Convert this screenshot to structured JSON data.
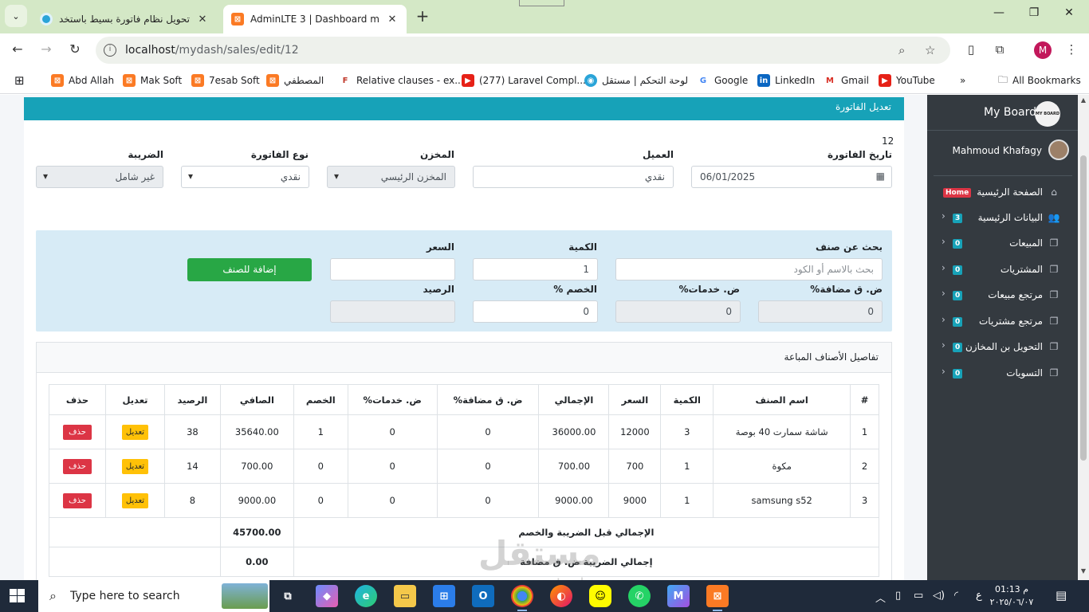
{
  "browser": {
    "tabs": [
      {
        "title": "تحويل نظام فاتورة بسيط باستخدام",
        "active": false
      },
      {
        "title": "AdminLTE 3 | Dashboard mood",
        "active": true
      }
    ],
    "url_host": "localhost",
    "url_path": "/mydash/sales/edit/12",
    "bookmarks": [
      "Abd Allah",
      "Mak Soft",
      "7esab Soft",
      "المصطفي",
      "Relative clauses - ex...",
      "(277) Laravel Compl...",
      "لوحة التحكم | مستقل",
      "Google",
      "LinkedIn",
      "Gmail",
      "YouTube"
    ],
    "all_bookmarks": "All Bookmarks",
    "profile_initial": "M"
  },
  "page": {
    "card_title": "تعديل الفاتورة",
    "invoice_number": "12",
    "labels": {
      "date": "تاريخ الفاتورة",
      "customer": "العميل",
      "store": "المخزن",
      "invoice_type": "نوع الفاتورة",
      "tax": "الضريبة"
    },
    "values": {
      "date": "06/01/2025",
      "customer": "نقدي",
      "store": "المخزن الرئيسي",
      "invoice_type": "نقدي",
      "tax": "غير شامل"
    },
    "item_form": {
      "search_label": "بحث عن صنف",
      "search_placeholder": "بحث بالاسم أو الكود",
      "qty_label": "الكمية",
      "qty_value": "1",
      "price_label": "السعر",
      "price_value": "",
      "add_button": "إضافة للصنف",
      "vat_label": "ض. ق مضافة%",
      "vat_value": "0",
      "service_label": "ض. خدمات%",
      "service_value": "0",
      "discount_label": "الخصم %",
      "discount_value": "0",
      "balance_label": "الرصيد",
      "balance_value": ""
    },
    "details": {
      "title": "تفاصيل الأصناف المباعة",
      "columns": [
        "#",
        "اسم الصنف",
        "الكمية",
        "السعر",
        "الإجمالي",
        "ض. ق مضافة%",
        "ض. خدمات%",
        "الخصم",
        "الصافي",
        "الرصيد",
        "تعديل",
        "حذف"
      ],
      "rows": [
        {
          "no": "1",
          "name": "شاشة سمارت 40 بوصة",
          "qty": "3",
          "price": "12000",
          "total": "36000.00",
          "vat": "0",
          "service": "0",
          "discount": "1",
          "net": "35640.00",
          "balance": "38"
        },
        {
          "no": "2",
          "name": "مكوة",
          "qty": "1",
          "price": "700",
          "total": "700.00",
          "vat": "0",
          "service": "0",
          "discount": "0",
          "net": "700.00",
          "balance": "14"
        },
        {
          "no": "3",
          "name": "samsung s52",
          "qty": "1",
          "price": "9000",
          "total": "9000.00",
          "vat": "0",
          "service": "0",
          "discount": "0",
          "net": "9000.00",
          "balance": "8"
        }
      ],
      "edit_label": "تعديل",
      "delete_label": "حذف",
      "totals": [
        {
          "label": "الإجمالي قبل الضريبة والخصم",
          "value": "45700.00"
        },
        {
          "label": "إجمالي الضريبة ض. ق مضافة",
          "value": "0.00"
        }
      ]
    }
  },
  "sidebar": {
    "brand": "My Board",
    "logo_text": "MY BOARD",
    "user": "Mahmoud Khafagy",
    "items": [
      {
        "label": "الصفحة الرئيسية",
        "badge": "Home",
        "icon": "home-icon"
      },
      {
        "label": "البيانات الرئيسية",
        "badge": "3",
        "icon": "users-icon"
      },
      {
        "label": "المبيعات",
        "badge": "0",
        "icon": "copy-icon"
      },
      {
        "label": "المشتريات",
        "badge": "0",
        "icon": "copy-icon"
      },
      {
        "label": "مرتجع مبيعات",
        "badge": "0",
        "icon": "copy-icon"
      },
      {
        "label": "مرتجع مشتريات",
        "badge": "0",
        "icon": "copy-icon"
      },
      {
        "label": "التحويل بن المخازن",
        "badge": "0",
        "icon": "copy-icon"
      },
      {
        "label": "التسويات",
        "badge": "0",
        "icon": "copy-icon"
      }
    ]
  },
  "taskbar": {
    "search_text": "Type here to search",
    "time": "01:13 م",
    "date": "٢٠٢٥/٠٦/٠٧",
    "lang": "ع"
  },
  "watermark": {
    "text": "مستقل",
    "sub": "mostaql.com"
  }
}
